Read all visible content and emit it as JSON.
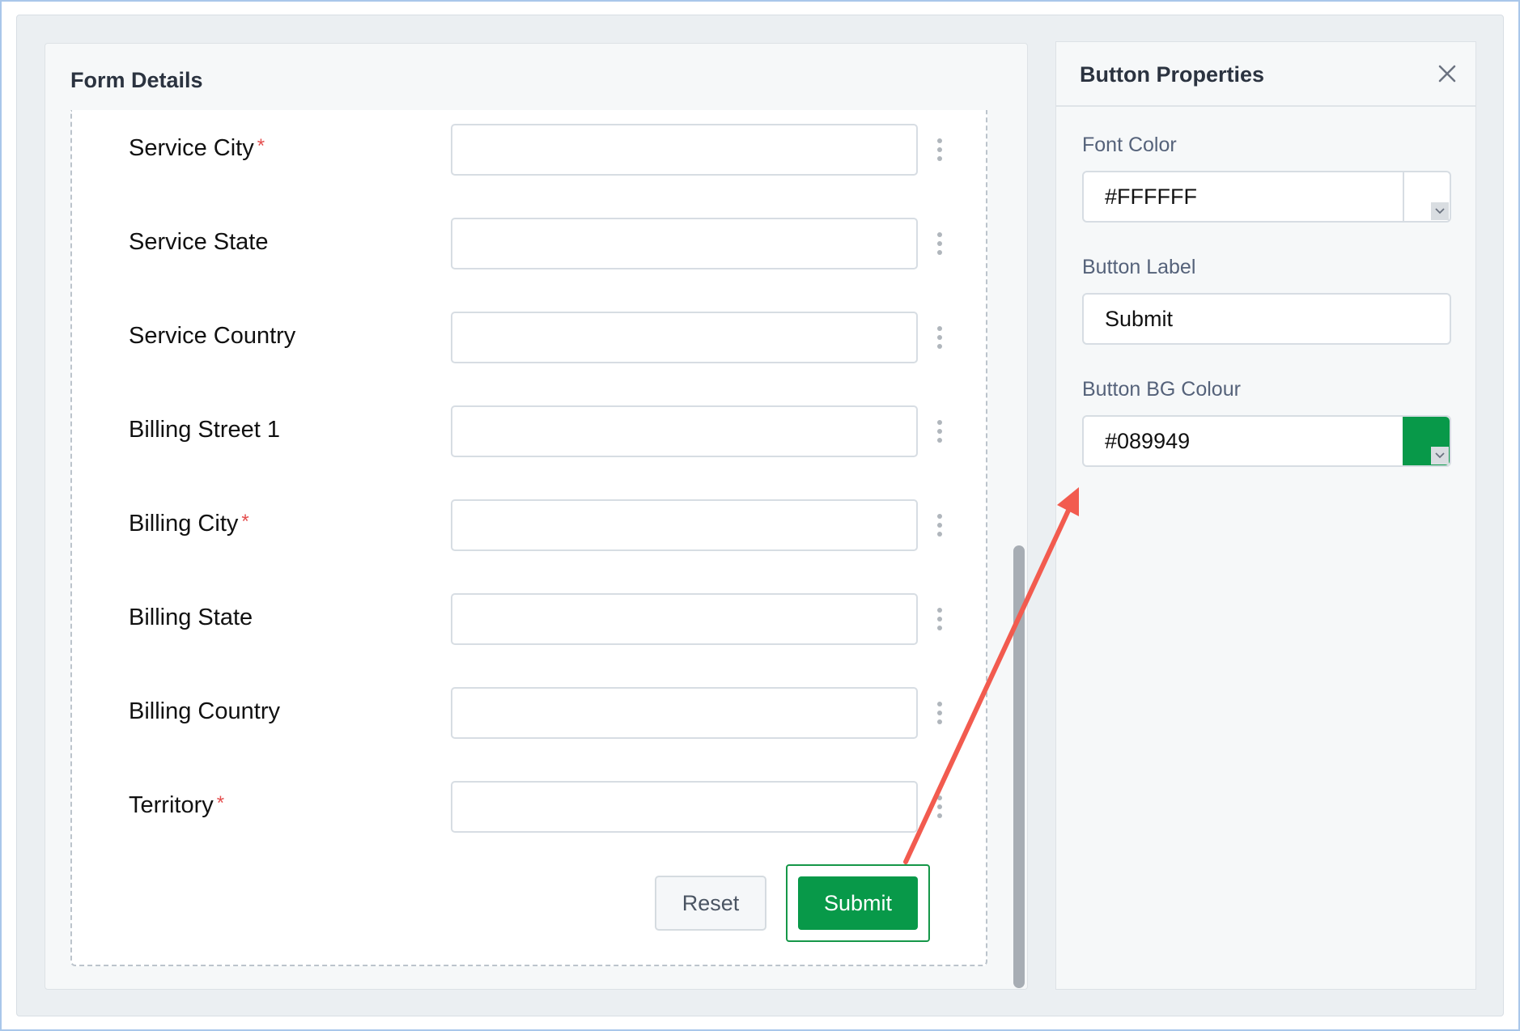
{
  "form": {
    "title": "Form Details",
    "fields": [
      {
        "label": "Service City",
        "required": "*"
      },
      {
        "label": "Service State",
        "required": ""
      },
      {
        "label": "Service Country",
        "required": ""
      },
      {
        "label": "Billing Street 1",
        "required": ""
      },
      {
        "label": "Billing City",
        "required": "*"
      },
      {
        "label": "Billing State",
        "required": ""
      },
      {
        "label": "Billing Country",
        "required": ""
      },
      {
        "label": "Territory",
        "required": "*"
      }
    ],
    "reset_label": "Reset",
    "submit_label": "Submit"
  },
  "properties": {
    "title": "Button Properties",
    "font_color_label": "Font Color",
    "font_color_value": "#FFFFFF",
    "button_label_label": "Button Label",
    "button_label_value": "Submit",
    "bg_colour_label": "Button BG Colour",
    "bg_colour_value": "#089949"
  },
  "colors": {
    "submit_bg": "#089949",
    "required_star": "#e44e4e",
    "annotation_arrow": "#f25b4f"
  },
  "icons": [
    "close-icon",
    "kebab-menu-icon",
    "chevron-down-icon"
  ]
}
